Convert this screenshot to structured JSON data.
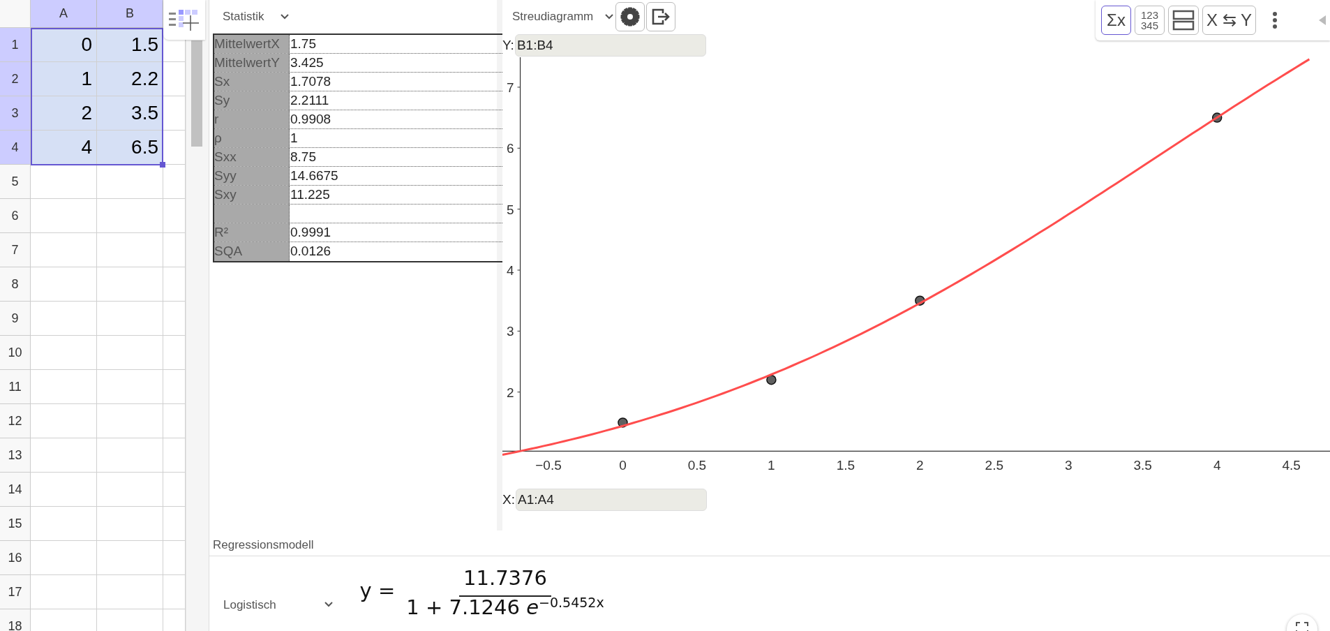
{
  "spreadsheet": {
    "columns": [
      {
        "label": "A",
        "selected": true
      },
      {
        "label": "B",
        "selected": true
      }
    ],
    "rows": [
      {
        "label": "1",
        "selected": true,
        "cells": [
          "0",
          "1.5"
        ]
      },
      {
        "label": "2",
        "selected": true,
        "cells": [
          "1",
          "2.2"
        ]
      },
      {
        "label": "3",
        "selected": true,
        "cells": [
          "2",
          "3.5"
        ]
      },
      {
        "label": "4",
        "selected": true,
        "cells": [
          "4",
          "6.5"
        ]
      },
      {
        "label": "5",
        "selected": false
      },
      {
        "label": "6",
        "selected": false
      },
      {
        "label": "7",
        "selected": false
      },
      {
        "label": "8",
        "selected": false
      },
      {
        "label": "9",
        "selected": false
      },
      {
        "label": "10",
        "selected": false
      },
      {
        "label": "11",
        "selected": false
      },
      {
        "label": "12",
        "selected": false
      },
      {
        "label": "13",
        "selected": false
      },
      {
        "label": "14",
        "selected": false
      },
      {
        "label": "15",
        "selected": false
      },
      {
        "label": "16",
        "selected": false
      },
      {
        "label": "17",
        "selected": false
      },
      {
        "label": "18",
        "selected": false
      }
    ]
  },
  "statistics": {
    "view": "Statistik",
    "rows": [
      {
        "label": "MittelwertX",
        "value": "1.75"
      },
      {
        "label": "MittelwertY",
        "value": "3.425"
      },
      {
        "label": "Sx",
        "value": "1.7078"
      },
      {
        "label": "Sy",
        "value": "2.2111"
      },
      {
        "label": "r",
        "value": "0.9908"
      },
      {
        "label": "ρ",
        "value": "1"
      },
      {
        "label": "Sxx",
        "value": "8.75"
      },
      {
        "label": "Syy",
        "value": "14.6675"
      },
      {
        "label": "Sxy",
        "value": "11.225"
      },
      {},
      {
        "label": "R²",
        "value": "0.9991"
      },
      {
        "label": "SQA",
        "value": "0.0126"
      }
    ]
  },
  "plot": {
    "view": "Streudiagramm",
    "y_field": {
      "label": "Y:",
      "value": "B1:B4"
    },
    "x_field": {
      "label": "X:",
      "value": "A1:A4"
    },
    "chart_data": {
      "type": "scatter",
      "x": [
        0,
        1,
        2,
        4
      ],
      "series": [
        {
          "color": "#606060",
          "values": [
            1.5,
            2.2,
            3.5,
            6.5
          ]
        }
      ],
      "xlim": [
        -0.81,
        4.76
      ],
      "ylim": [
        -0.27,
        8.43
      ],
      "xticks": [
        {
          "value": -0.5,
          "label": "−0.5"
        },
        0,
        0.5,
        1,
        1.5,
        2,
        2.5,
        3,
        3.5,
        4,
        4.5
      ],
      "yticks": [
        2,
        3,
        4,
        5,
        6,
        7
      ]
    }
  },
  "toolbar": [
    {
      "kind": "text",
      "label": "Σx",
      "selected": true
    },
    {
      "kind": "stack",
      "lines": [
        "123",
        "345"
      ],
      "selected": false
    },
    {
      "kind": "split",
      "selected": false
    },
    {
      "kind": "text",
      "label": "X ⇆ Y",
      "selected": false
    }
  ],
  "regression": {
    "title": "Regressionsmodell",
    "model": "Logistisch",
    "formula": {
      "lhs": "y =",
      "numerator": "11.7376",
      "denominator": "1 + 7.1246 *e*$^{−0.5452x}$"
    }
  }
}
